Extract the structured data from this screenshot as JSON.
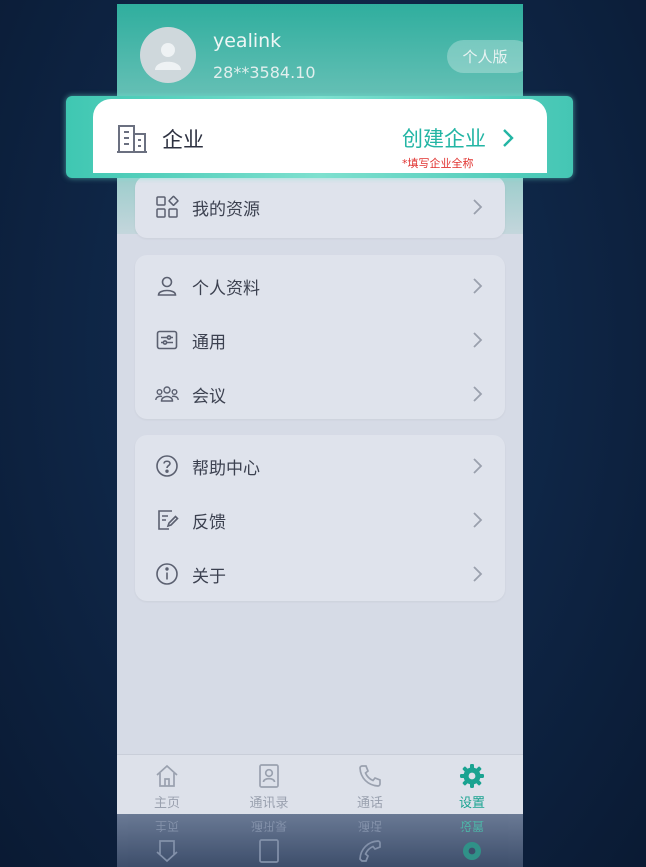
{
  "profile": {
    "username": "yealink",
    "user_id": "28**3584.10",
    "edition_badge": "个人版"
  },
  "enterprise": {
    "label": "企业",
    "create_label": "创建企业",
    "hint": "*填写企业全称"
  },
  "menu": {
    "resources": "我的资源",
    "personal_info": "个人资料",
    "general": "通用",
    "meeting": "会议",
    "help_center": "帮助中心",
    "feedback": "反馈",
    "about": "关于"
  },
  "tabs": [
    {
      "label": "主页",
      "icon": "home-icon"
    },
    {
      "label": "通讯录",
      "icon": "contacts-icon"
    },
    {
      "label": "通话",
      "icon": "phone-icon"
    },
    {
      "label": "设置",
      "icon": "gear-icon",
      "active": true
    }
  ],
  "colors": {
    "accent": "#1aa391",
    "hint_red": "#e0322f",
    "highlight_frame": "#3fc7b2"
  }
}
